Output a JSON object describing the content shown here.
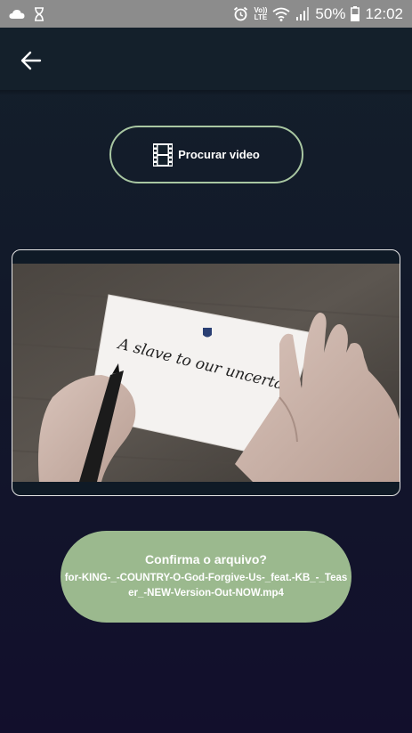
{
  "status_bar": {
    "volte_top": "Vo))",
    "volte_bottom": "LTE",
    "battery": "50%",
    "time": "12:02",
    "icons": [
      "cloud-icon",
      "hourglass-icon",
      "alarm-icon",
      "volte-icon",
      "wifi-icon",
      "signal-icon",
      "battery-icon"
    ]
  },
  "header": {
    "back_icon": "arrow-left-icon"
  },
  "browse": {
    "icon": "film-strip-icon",
    "label": "Procurar video"
  },
  "video": {
    "handwritten_text": "A slave to our uncertainty"
  },
  "confirm": {
    "title": "Confirma o arquivo?",
    "filename": "for-KING-_-COUNTRY-O-God-Forgive-Us-_feat.-KB_-_Teaser_-NEW-Version-Out-NOW.mp4"
  },
  "colors": {
    "background": "#14202b",
    "accent_green": "#9bb98e",
    "border_green": "#a9c7a2",
    "status_bar": "#8c8c8c"
  }
}
